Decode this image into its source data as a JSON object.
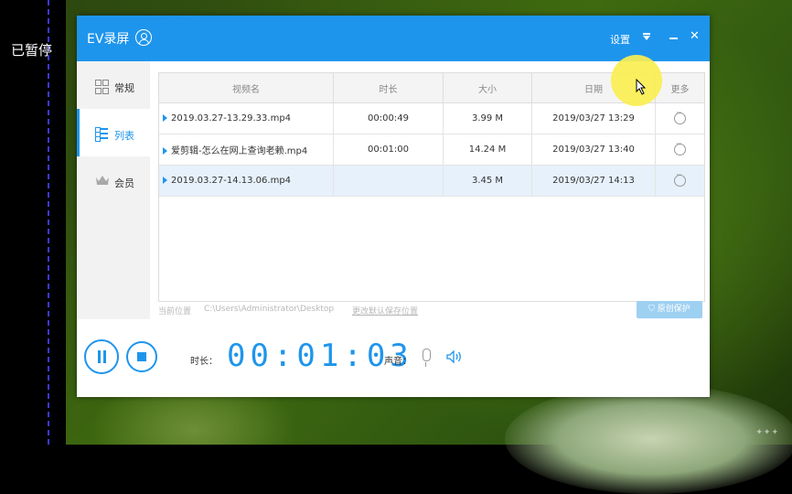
{
  "overlay": {
    "paused_label": "已暂停"
  },
  "window": {
    "title": "EV录屏",
    "settings_label": "设置"
  },
  "sidebar": {
    "items": [
      {
        "label": "常规",
        "icon": "grid-icon",
        "active": false
      },
      {
        "label": "列表",
        "icon": "list-icon",
        "active": true
      },
      {
        "label": "会员",
        "icon": "crown-icon",
        "active": false
      }
    ]
  },
  "table": {
    "headers": [
      "视频名",
      "时长",
      "大小",
      "日期",
      "更多"
    ],
    "rows": [
      {
        "name": "2019.03.27-13.29.33.mp4",
        "duration": "00:00:49",
        "size": "3.99 M",
        "date": "2019/03/27 13:29"
      },
      {
        "name": "爱剪辑-怎么在网上查询老赖.mp4",
        "duration": "00:01:00",
        "size": "14.24 M",
        "date": "2019/03/27 13:40"
      },
      {
        "name": "2019.03.27-14.13.06.mp4",
        "duration": "",
        "size": "3.45 M",
        "date": "2019/03/27 14:13"
      }
    ]
  },
  "path": {
    "label": "当前位置",
    "value": "C:\\Users\\Administrator\\Desktop",
    "change_link": "更改默认保存位置",
    "protect_button": "原创保护"
  },
  "recorder": {
    "duration_label": "时长：",
    "timer": "00:01:03",
    "sound_label": "声音："
  },
  "colors": {
    "accent": "#1e95ec",
    "cursor_highlight": "#faee50"
  }
}
